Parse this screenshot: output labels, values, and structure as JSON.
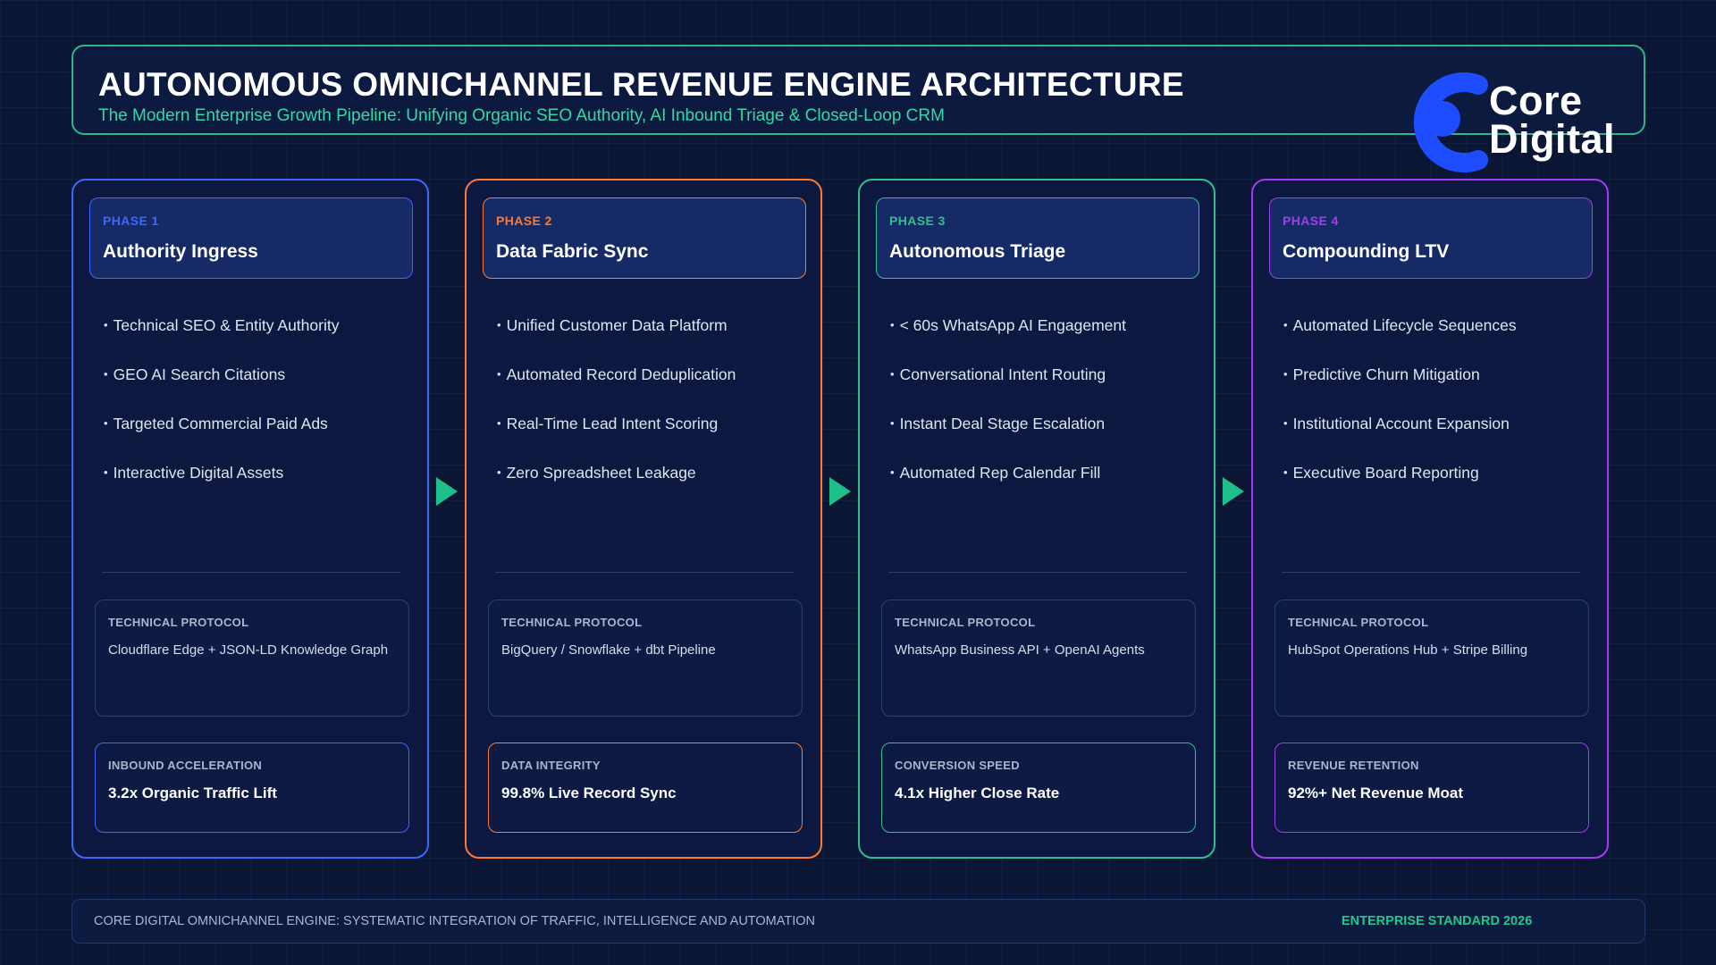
{
  "header": {
    "title": "AUTONOMOUS OMNICHANNEL REVENUE ENGINE ARCHITECTURE",
    "subtitle": "The Modern Enterprise Growth Pipeline: Unifying Organic SEO Authority, AI Inbound Triage & Closed-Loop CRM"
  },
  "logo": {
    "line1": "Core",
    "line2": "Digital",
    "icon": "core-digital-logo-icon",
    "color": "#1d4dff"
  },
  "phases": [
    {
      "number": "PHASE 1",
      "name": "Authority Ingress",
      "accent": "#3f66ff",
      "bullets": [
        "Technical SEO & Entity Authority",
        "GEO AI Search Citations",
        "Targeted Commercial Paid Ads",
        "Interactive Digital Assets"
      ],
      "protocol_label": "TECHNICAL PROTOCOL",
      "protocol_value": "Cloudflare Edge + JSON-LD Knowledge Graph",
      "metric_label": "INBOUND ACCELERATION",
      "metric_value": "3.2x Organic Traffic Lift"
    },
    {
      "number": "PHASE 2",
      "name": "Data Fabric Sync",
      "accent": "#ff7a2e",
      "bullets": [
        "Unified Customer Data Platform",
        "Automated Record Deduplication",
        "Real-Time Lead Intent Scoring",
        "Zero Spreadsheet Leakage"
      ],
      "protocol_label": "TECHNICAL PROTOCOL",
      "protocol_value": "BigQuery / Snowflake + dbt Pipeline",
      "metric_label": "DATA INTEGRITY",
      "metric_value": "99.8% Live Record Sync"
    },
    {
      "number": "PHASE 3",
      "name": "Autonomous Triage",
      "accent": "#2fc08e",
      "bullets": [
        "< 60s WhatsApp AI Engagement",
        "Conversational Intent Routing",
        "Instant Deal Stage Escalation",
        "Automated Rep Calendar Fill"
      ],
      "protocol_label": "TECHNICAL PROTOCOL",
      "protocol_value": "WhatsApp Business API + OpenAI Agents",
      "metric_label": "CONVERSION SPEED",
      "metric_value": "4.1x Higher Close Rate"
    },
    {
      "number": "PHASE 4",
      "name": "Compounding LTV",
      "accent": "#a23cf0",
      "bullets": [
        "Automated Lifecycle Sequences",
        "Predictive Churn Mitigation",
        "Institutional Account Expansion",
        "Executive Board Reporting"
      ],
      "protocol_label": "TECHNICAL PROTOCOL",
      "protocol_value": "HubSpot Operations Hub + Stripe Billing",
      "metric_label": "REVENUE RETENTION",
      "metric_value": "92%+ Net Revenue Moat"
    }
  ],
  "arrow_color": "#1fbf8a",
  "footer": {
    "left": "CORE DIGITAL OMNICHANNEL ENGINE: SYSTEMATIC INTEGRATION OF TRAFFIC, INTELLIGENCE AND AUTOMATION",
    "right": "ENTERPRISE STANDARD 2026"
  }
}
